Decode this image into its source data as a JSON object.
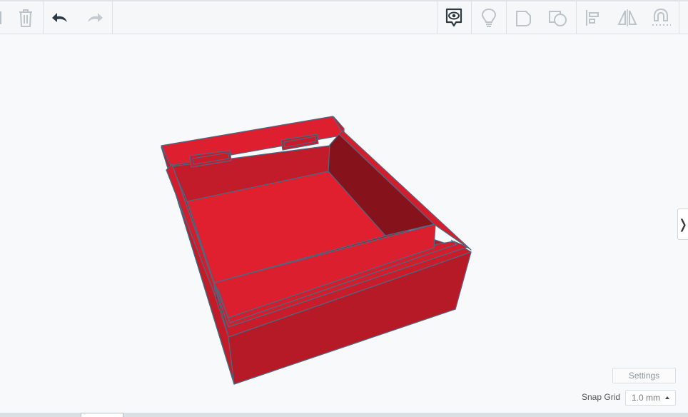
{
  "toolbar": {
    "left_tools": [
      "copy-edge-icon",
      "trash-icon",
      "undo-icon",
      "redo-icon"
    ],
    "right_tools": [
      "notes-icon",
      "lightbulb-icon",
      "shape-icon",
      "workplane-icon",
      "align-icon",
      "mirror-icon",
      "magnet-icon"
    ]
  },
  "viewport": {
    "object_color": "#e0202f",
    "edge_color": "#4a6a84",
    "background": "#f8f9fa"
  },
  "settings": {
    "label": "Settings"
  },
  "snap_grid": {
    "label": "Snap Grid",
    "value": "1.0 mm"
  },
  "side_panel": {
    "toggle_glyph": "❭"
  }
}
